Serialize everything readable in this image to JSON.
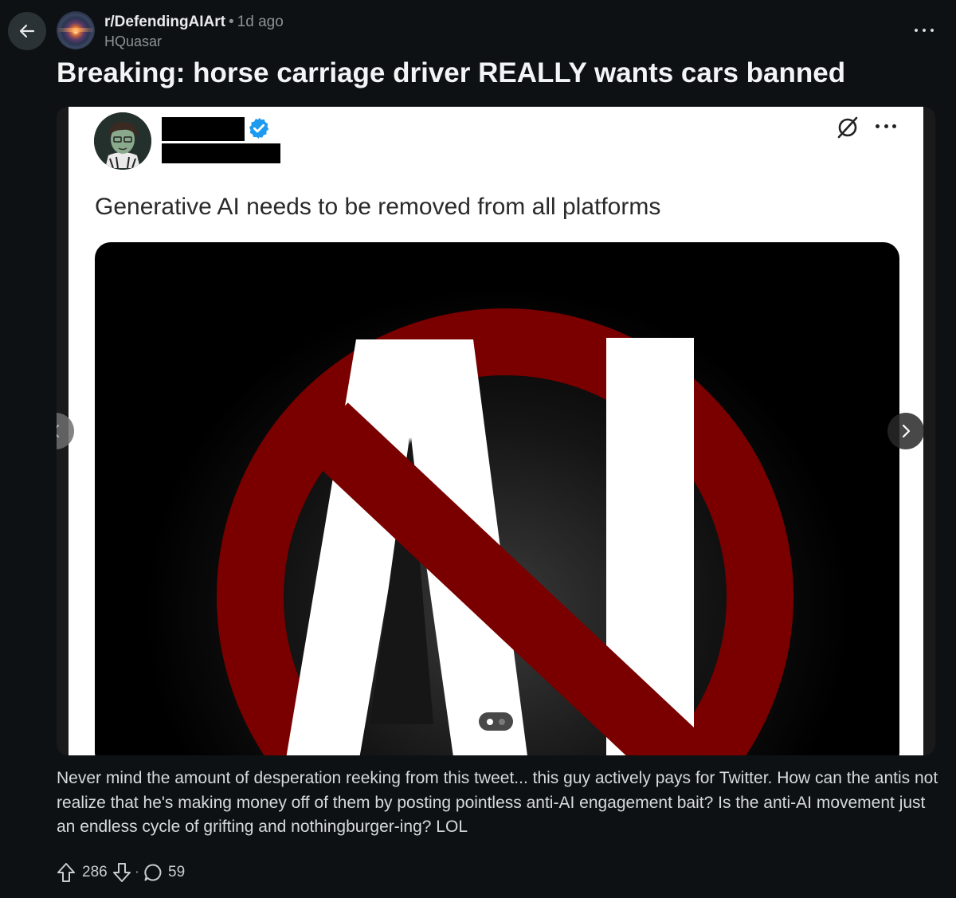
{
  "header": {
    "subreddit": "r/DefendingAIArt",
    "separator": "•",
    "time_ago": "1d ago",
    "author": "HQuasar"
  },
  "post": {
    "title": "Breaking: horse carriage driver REALLY wants cars banned",
    "body": "Never mind the amount of desperation reeking from this tweet... this guy actively pays for Twitter. How can the antis not realize that he's making money off of them by posting pointless anti-AI engagement bait? Is the anti-AI movement just an endless cycle of grifting and nothingburger-ing? LOL"
  },
  "embedded_tweet": {
    "text": "Generative AI needs to be removed from all platforms",
    "image_letters": "AI"
  },
  "gallery": {
    "total_images": 2,
    "current_index": 1
  },
  "actions": {
    "score": "286",
    "separator": "·",
    "comments": "59"
  },
  "colors": {
    "background": "#0e1113",
    "prohibition_red": "#7a0000",
    "verified_blue": "#1d9bf0"
  },
  "icons": {
    "back": "arrow-left-icon",
    "more": "more-horizontal-icon",
    "upvote": "upvote-arrow-icon",
    "downvote": "downvote-arrow-icon",
    "comments": "comment-bubble-icon",
    "gallery_prev": "chevron-left-icon",
    "gallery_next": "chevron-right-icon",
    "verified": "verified-badge-icon",
    "grok": "grok-icon"
  }
}
